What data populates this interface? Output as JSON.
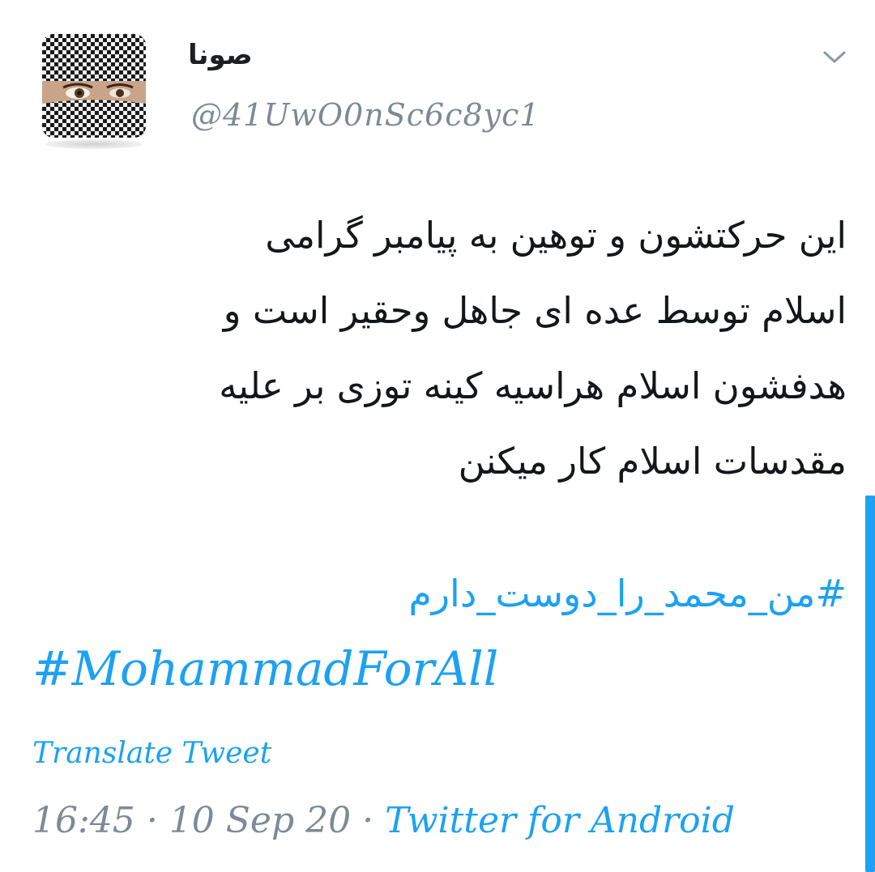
{
  "tweet": {
    "display_name": "صونا",
    "handle": "@41UwO0nSc6c8yc1",
    "body_lines": [
      "این حرکتشون و توهین به پیامبر گرامی",
      "اسلام توسط عده ای جاهل وحقیر است و",
      "هدفشون اسلام هراسیه کینه توزی بر علیه",
      "مقدسات اسلام کار میکنن"
    ],
    "hashtag_fa": "#من_محمد_را_دوست_دارم",
    "hashtag_en": "#MohammadForAll",
    "translate_label": "Translate Tweet",
    "time": "16:45",
    "separator": "·",
    "date": "10 Sep 20",
    "source": "Twitter for Android"
  },
  "icons": {
    "menu": "chevron-down-icon",
    "avatar": "profile-avatar"
  },
  "colors": {
    "link": "#1da1f2",
    "text": "#14171a",
    "muted": "#7d8a95",
    "background": "#ffffff"
  }
}
